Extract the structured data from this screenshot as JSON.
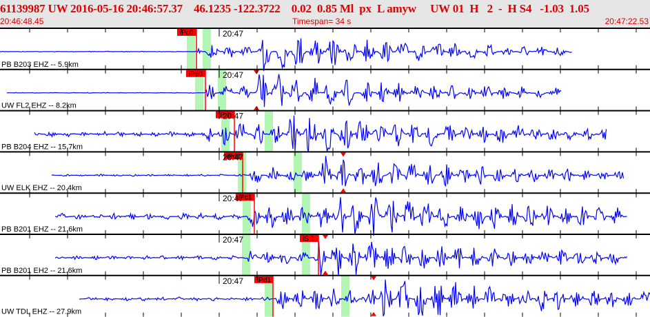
{
  "header": {
    "title": "61139987 UW 2016-05-16 20:46:57.37    46.1235 -122.3722    0.02  0.85 Ml  px  L amyw     UW 01  H   2  -  H S4   -1.03  1.05",
    "start_time": "20:46:48.45",
    "timespan": "Timespan=  34 s",
    "end_time": "20:47:22.53"
  },
  "colors": {
    "trace": "#0000ff",
    "pick": "#ff0000",
    "window": "#b3f5b3",
    "header_text": "#e00000"
  },
  "time_label": "20:47",
  "panels": [
    {
      "station": "PB B203 EHZ -- 5.9km",
      "pick": "iPc0"
    },
    {
      "station": "UW FL2 EHZ -- 8.2km",
      "pick": "iPd0"
    },
    {
      "station": "PB B204 EHZ -- 15.7km",
      "pick": "iP 1"
    },
    {
      "station": "UW ELK EHZ -- 20.4km",
      "pick": "iPd1"
    },
    {
      "station": "PB B201 EHZ -- 21.6km",
      "pick": "iPc1"
    },
    {
      "station": "PB B201 EH2 -- 21.6km",
      "pick": "iS 1"
    },
    {
      "station": "UW TDL EHZ -- 27.9km",
      "pick": "iPd1"
    }
  ]
}
